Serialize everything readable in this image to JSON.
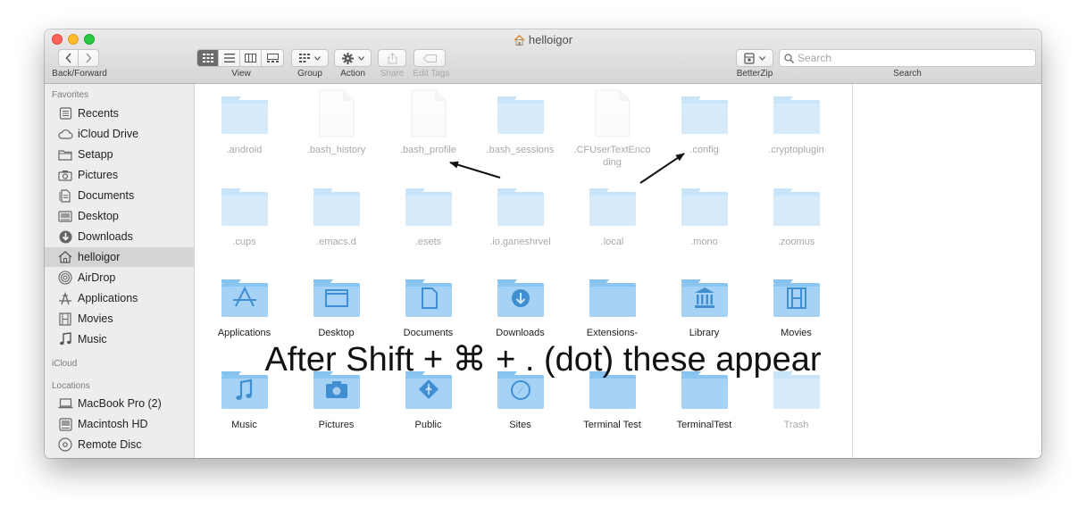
{
  "window": {
    "title": "helloigor",
    "title_icon": "home-icon"
  },
  "toolbar": {
    "back_forward_label": "Back/Forward",
    "view_label": "View",
    "group_label": "Group",
    "action_label": "Action",
    "share_label": "Share",
    "edit_tags_label": "Edit Tags",
    "betterzip_label": "BetterZip",
    "search_label": "Search",
    "search_placeholder": "Search",
    "view_modes": [
      "icon",
      "list",
      "column",
      "gallery"
    ],
    "active_view_mode": "icon"
  },
  "sidebar": {
    "favorites_header": "Favorites",
    "favorites": [
      {
        "label": "Recents",
        "icon": "recents-icon"
      },
      {
        "label": "iCloud Drive",
        "icon": "cloud-icon"
      },
      {
        "label": "Setapp",
        "icon": "folder-icon"
      },
      {
        "label": "Pictures",
        "icon": "camera-icon"
      },
      {
        "label": "Documents",
        "icon": "document-icon"
      },
      {
        "label": "Desktop",
        "icon": "desktop-icon"
      },
      {
        "label": "Downloads",
        "icon": "download-icon"
      },
      {
        "label": "helloigor",
        "icon": "home-icon",
        "selected": true
      },
      {
        "label": "AirDrop",
        "icon": "airdrop-icon"
      },
      {
        "label": "Applications",
        "icon": "applications-icon"
      },
      {
        "label": "Movies",
        "icon": "film-icon"
      },
      {
        "label": "Music",
        "icon": "music-note-icon"
      }
    ],
    "icloud_header": "iCloud",
    "locations_header": "Locations",
    "locations": [
      {
        "label": "MacBook Pro (2)",
        "icon": "laptop-icon"
      },
      {
        "label": "Macintosh HD",
        "icon": "hard-drive-icon"
      },
      {
        "label": "Remote Disc",
        "icon": "disc-icon"
      }
    ]
  },
  "files": [
    {
      "label": ".android",
      "kind": "folder",
      "hidden": true
    },
    {
      "label": ".bash_history",
      "kind": "file",
      "hidden": true
    },
    {
      "label": ".bash_profile",
      "kind": "file",
      "hidden": true
    },
    {
      "label": ".bash_sessions",
      "kind": "folder",
      "hidden": true
    },
    {
      "label": ".CFUserTextEncoding",
      "kind": "file",
      "hidden": true
    },
    {
      "label": ".config",
      "kind": "folder",
      "hidden": true
    },
    {
      "label": ".cryptoplugin",
      "kind": "folder",
      "hidden": true
    },
    {
      "label": ".cups",
      "kind": "folder",
      "hidden": true
    },
    {
      "label": ".emacs.d",
      "kind": "folder",
      "hidden": true
    },
    {
      "label": ".esets",
      "kind": "folder",
      "hidden": true
    },
    {
      "label": ".io.ganeshrvel",
      "kind": "folder",
      "hidden": true
    },
    {
      "label": ".local",
      "kind": "folder",
      "hidden": true
    },
    {
      "label": ".mono",
      "kind": "folder",
      "hidden": true
    },
    {
      "label": ".zoomus",
      "kind": "folder",
      "hidden": true
    },
    {
      "label": "Applications",
      "kind": "folder",
      "badge": "applications-icon"
    },
    {
      "label": "Desktop",
      "kind": "folder",
      "badge": "desktop-window-icon"
    },
    {
      "label": "Documents",
      "kind": "folder",
      "badge": "document-icon"
    },
    {
      "label": "Downloads",
      "kind": "folder",
      "badge": "download-icon"
    },
    {
      "label": "Extensions-",
      "kind": "folder"
    },
    {
      "label": "Library",
      "kind": "folder",
      "badge": "library-icon"
    },
    {
      "label": "Movies",
      "kind": "folder",
      "badge": "film-icon"
    },
    {
      "label": "Music",
      "kind": "folder",
      "badge": "music-note-icon"
    },
    {
      "label": "Pictures",
      "kind": "folder",
      "badge": "camera-icon"
    },
    {
      "label": "Public",
      "kind": "folder",
      "badge": "public-icon"
    },
    {
      "label": "Sites",
      "kind": "folder",
      "badge": "compass-icon"
    },
    {
      "label": "Terminal Test",
      "kind": "folder"
    },
    {
      "label": "TerminalTest",
      "kind": "folder"
    },
    {
      "label": "Trash",
      "kind": "folder",
      "hidden": true
    }
  ],
  "annotation": {
    "text": "After Shift + ⌘ + . (dot) these appear"
  }
}
